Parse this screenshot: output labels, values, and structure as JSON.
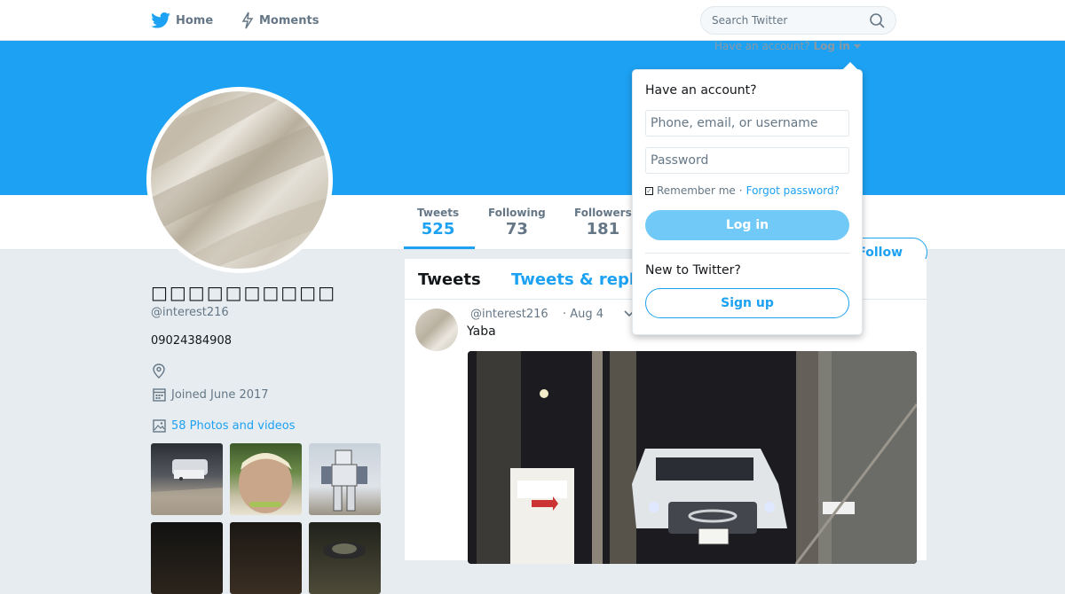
{
  "nav": {
    "home_label": "Home",
    "moments_label": "Moments",
    "search_placeholder": "Search Twitter"
  },
  "login_prompt": {
    "text": "Have an account?",
    "link": "Log in"
  },
  "profile": {
    "name": "□□□□□□□□□□",
    "handle": "@interest216",
    "bio": "09024384908",
    "joined": "Joined June 2017",
    "photos_link": "58 Photos and videos"
  },
  "stats": [
    {
      "label": "Tweets",
      "value": "525",
      "active": true
    },
    {
      "label": "Following",
      "value": "73",
      "active": false
    },
    {
      "label": "Followers",
      "value": "181",
      "active": false
    }
  ],
  "follow_label": "Follow",
  "tabs": {
    "tweets": "Tweets",
    "replies": "Tweets & repl"
  },
  "tweet": {
    "handle": "@interest216",
    "date": "· Aug 4",
    "text": "Yaba"
  },
  "dropdown": {
    "title": "Have an account?",
    "username_placeholder": "Phone, email, or username",
    "password_placeholder": "Password",
    "remember": "Remember me",
    "separator": "·",
    "forgot": "Forgot password?",
    "login_button": "Log in",
    "new_prompt": "New to Twitter?",
    "signup_button": "Sign up"
  },
  "icons": [
    "twitter-bird-icon",
    "lightning-icon",
    "search-icon",
    "location-icon",
    "calendar-icon",
    "image-icon",
    "caret-down-icon"
  ],
  "colors": {
    "accent": "#1da1f2",
    "banner": "#1da1f2",
    "background": "#e6ecf0"
  }
}
